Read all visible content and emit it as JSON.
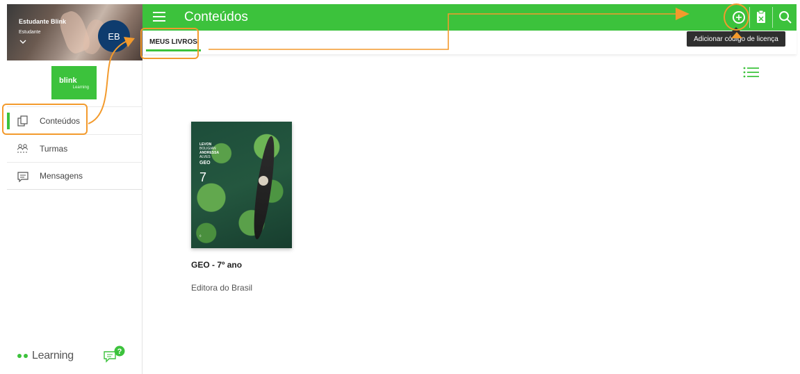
{
  "sidebar": {
    "user_name": "Estudante Blink",
    "user_role": "Estudante",
    "avatar_initials": "EB",
    "brand": {
      "name": "blink",
      "sub": "Learning"
    },
    "items": [
      {
        "label": "Conteúdos",
        "icon": "pages-icon",
        "active": true
      },
      {
        "label": "Turmas",
        "icon": "people-icon",
        "active": false
      },
      {
        "label": "Mensagens",
        "icon": "message-icon",
        "active": false
      }
    ],
    "footer_logo": "Learning",
    "help_badge": "?"
  },
  "header": {
    "title": "Conteúdos",
    "accent_color": "#3cc23c"
  },
  "tabs": [
    {
      "label": "MEUS LIVROS",
      "active": true
    }
  ],
  "tooltip": "Adicionar código de licença",
  "books": [
    {
      "title": "GEO - 7º ano",
      "publisher": "Editora do Brasil",
      "cover": {
        "author1": "LEVON",
        "author1_last": "BOLIGIAN",
        "author2": "ANDRESSA",
        "author2_last": "ALVES",
        "subject": "GEO",
        "grade": "7"
      }
    }
  ],
  "annotation_color": "#f39a2c"
}
